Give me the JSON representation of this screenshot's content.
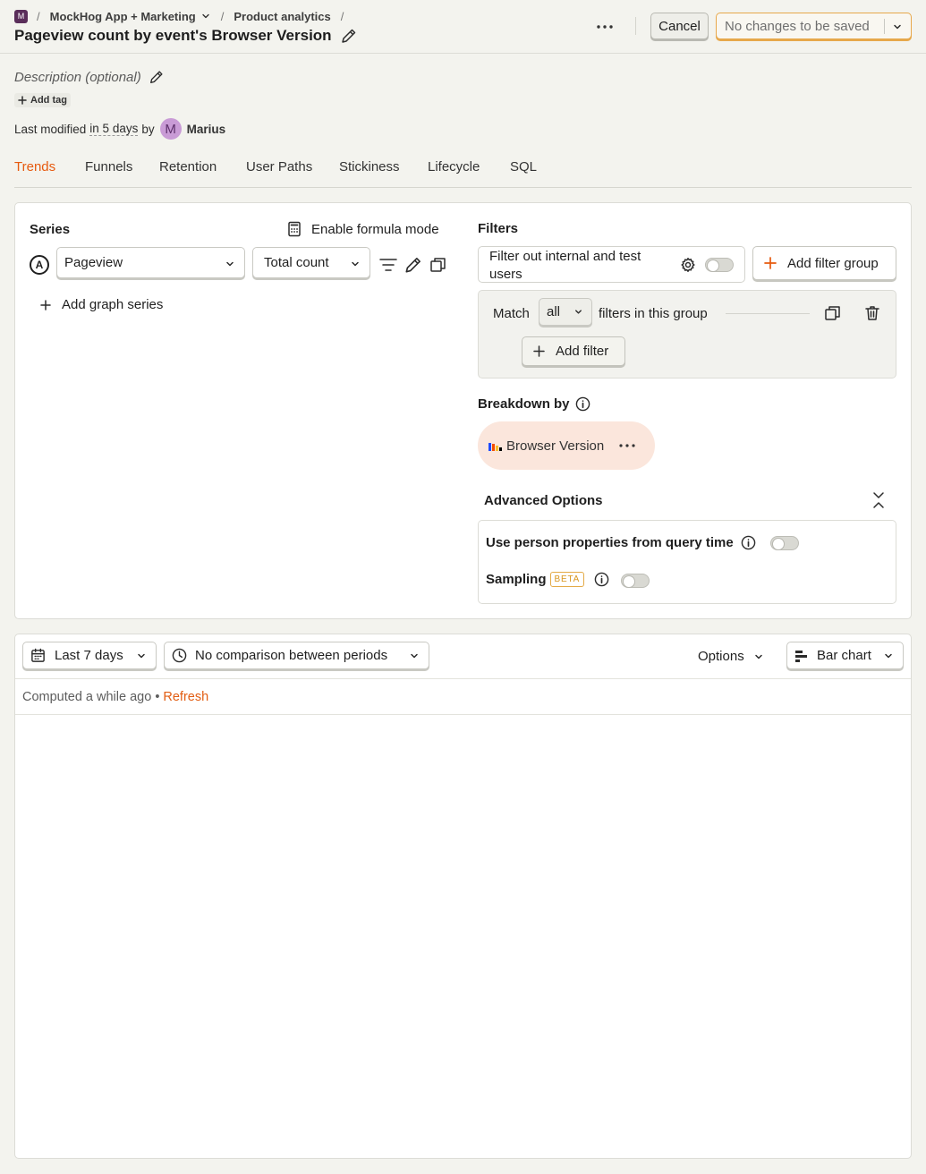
{
  "breadcrumb": {
    "project_badge": "M",
    "sep1": "/",
    "project": "MockHog App + Marketing",
    "sep2": "/",
    "section": "Product analytics",
    "sep3": "/"
  },
  "page": {
    "title": "Pageview count by event's Browser Version"
  },
  "header": {
    "cancel_label": "Cancel",
    "save_label": "No changes to be saved"
  },
  "meta": {
    "description_placeholder": "Description (optional)",
    "add_tag_label": "Add tag",
    "modified_prefix": "Last modified",
    "modified_when": "in 5 days",
    "modified_by_word": "by",
    "avatar_letter": "M",
    "user": "Marius"
  },
  "tabs": [
    {
      "label": "Trends",
      "active": true
    },
    {
      "label": "Funnels"
    },
    {
      "label": "Retention"
    },
    {
      "label": "User Paths"
    },
    {
      "label": "Stickiness"
    },
    {
      "label": "Lifecycle"
    },
    {
      "label": "SQL"
    }
  ],
  "series": {
    "heading": "Series",
    "formula_label": "Enable formula mode",
    "letter": "A",
    "event": "Pageview",
    "math": "Total count",
    "add_label": "Add graph series"
  },
  "filters": {
    "heading": "Filters",
    "internal_label": "Filter out internal and test users",
    "internal_enabled": false,
    "add_group_label": "Add filter group",
    "match_prefix": "Match",
    "match_value": "all",
    "match_suffix": "filters in this group",
    "add_filter_label": "Add filter"
  },
  "breakdown": {
    "heading": "Breakdown by",
    "value": "Browser Version"
  },
  "advanced": {
    "heading": "Advanced Options",
    "person_props_label": "Use person properties from query time",
    "person_props_enabled": false,
    "sampling_label": "Sampling",
    "beta_badge": "BETA",
    "sampling_enabled": false
  },
  "results": {
    "date_range": "Last 7 days",
    "comparison": "No comparison between periods",
    "options_label": "Options",
    "chart_type": "Bar chart",
    "computed_text": "Computed a while ago •",
    "refresh_label": "Refresh"
  },
  "colors": {
    "accent": "#e65a0f",
    "save_border": "#e7a84b",
    "beta": "#d8951d"
  }
}
